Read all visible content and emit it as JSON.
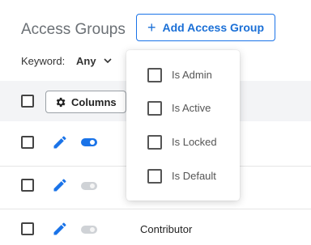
{
  "header": {
    "title": "Access Groups",
    "add_button_label": "Add Access Group",
    "add_button_icon": "plus-icon"
  },
  "filter": {
    "keyword_label": "Keyword:",
    "keyword_value": "Any"
  },
  "table": {
    "columns_button_label": "Columns",
    "rows": [
      {
        "active": true,
        "name": ""
      },
      {
        "active": false,
        "name": ""
      },
      {
        "active": false,
        "name": "Contributor"
      }
    ]
  },
  "columns_menu": {
    "items": [
      {
        "label": "Is Admin",
        "checked": false
      },
      {
        "label": "Is Active",
        "checked": false
      },
      {
        "label": "Is Locked",
        "checked": false
      },
      {
        "label": "Is Default",
        "checked": false
      }
    ]
  },
  "colors": {
    "accent": "#1a73e8",
    "header_bg": "#f3f4f6",
    "toggle_off": "#cfd2d6"
  }
}
